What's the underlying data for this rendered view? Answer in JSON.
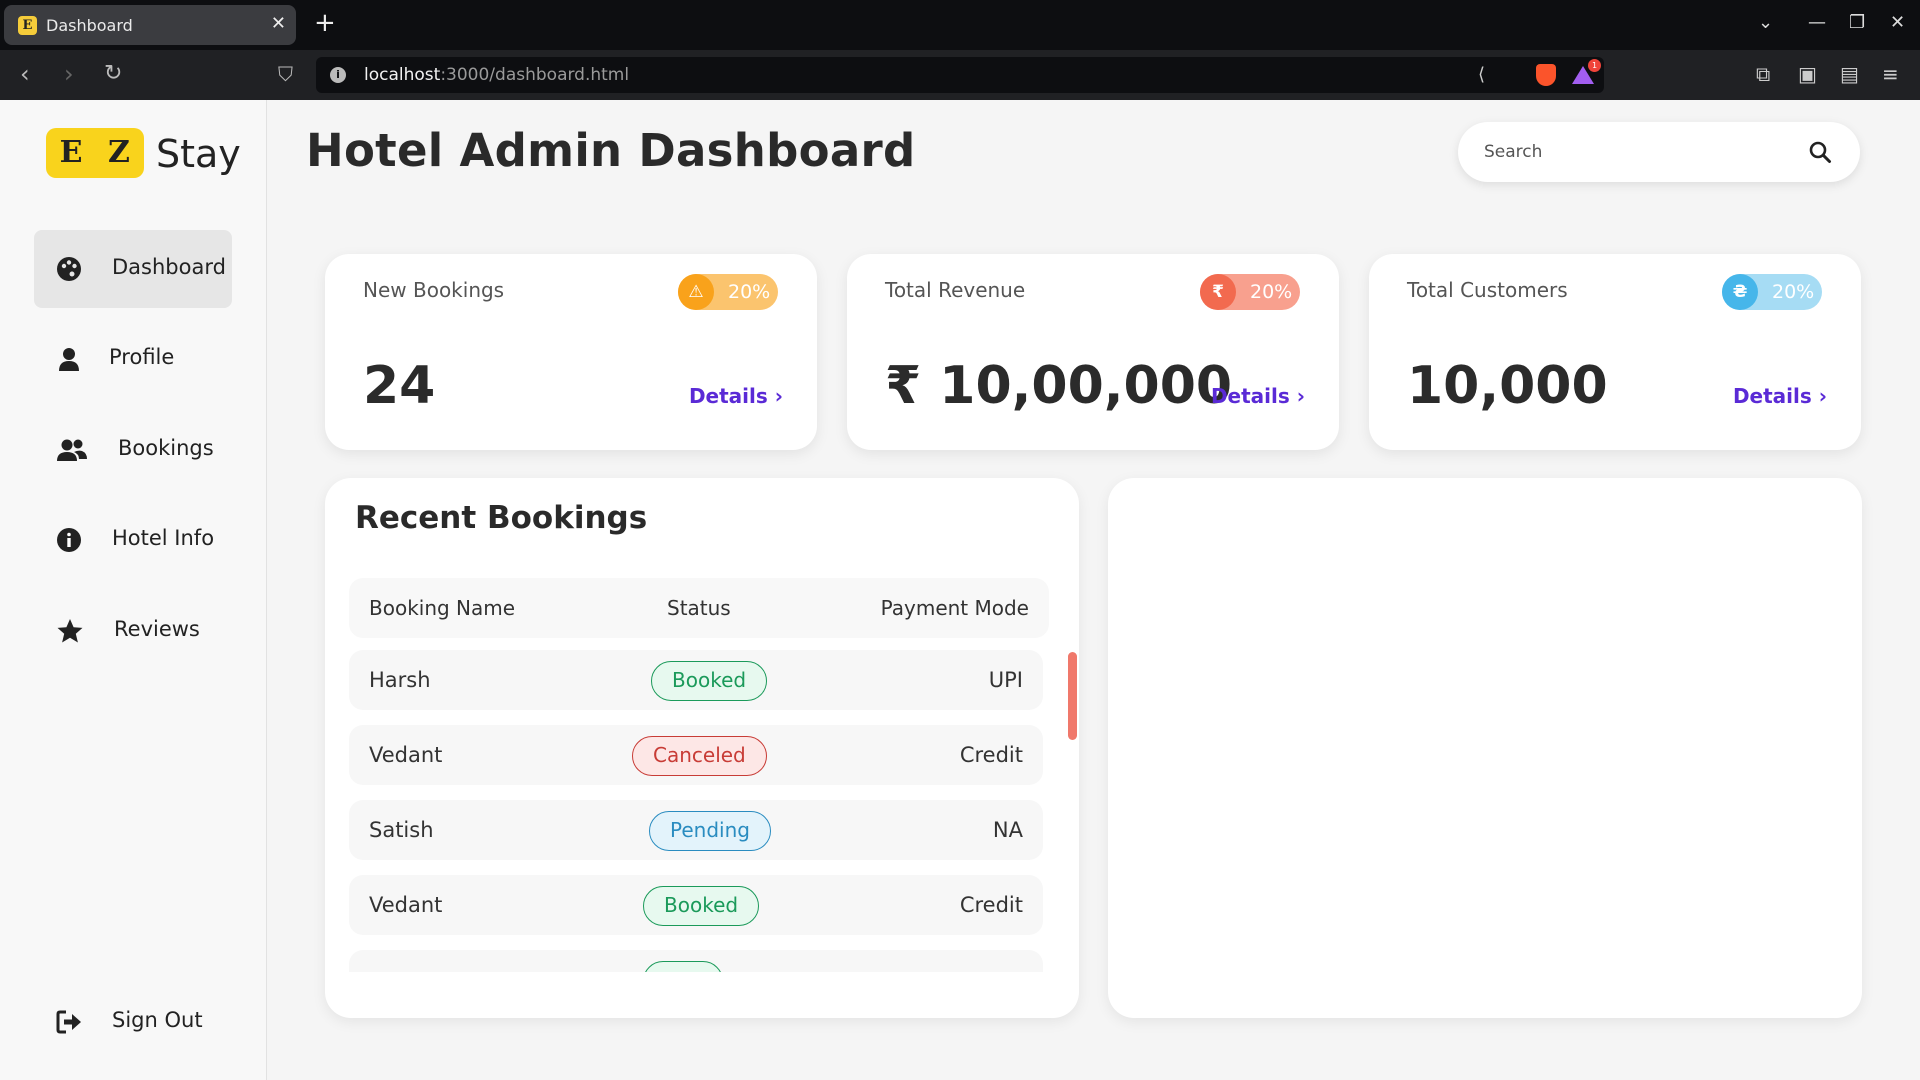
{
  "browser": {
    "tab_title": "Dashboard",
    "favicon_letter": "E",
    "url_host": "localhost",
    "url_path": ":3000/dashboard.html",
    "rewards_count": "1"
  },
  "logo": {
    "letter1": "E",
    "letter2": "Z",
    "word": "Stay"
  },
  "sidebar": {
    "items": [
      {
        "label": "Dashboard",
        "icon": "palette-icon",
        "active": true
      },
      {
        "label": "Profile",
        "icon": "user-icon",
        "active": false
      },
      {
        "label": "Bookings",
        "icon": "users-icon",
        "active": false
      },
      {
        "label": "Hotel Info",
        "icon": "info-icon",
        "active": false
      },
      {
        "label": "Reviews",
        "icon": "star-icon",
        "active": false
      }
    ],
    "signout": "Sign Out"
  },
  "header": {
    "title": "Hotel Admin Dashboard",
    "search_placeholder": "Search"
  },
  "stats": [
    {
      "title": "New Bookings",
      "badge": "20%",
      "value": "24",
      "details": "Details ›",
      "icon": "warning-icon",
      "icon_glyph": "⚠",
      "color": "#f9a21b",
      "light": "#fbc46e"
    },
    {
      "title": "Total Revenue",
      "badge": "20%",
      "value": "₹ 10,00,000",
      "details": "Details ›",
      "icon": "rupee-icon",
      "icon_glyph": "₹",
      "color": "#f26a4f",
      "light": "#f8a08e"
    },
    {
      "title": "Total Customers",
      "badge": "20%",
      "value": "10,000",
      "details": "Details ›",
      "icon": "hryvnia-icon",
      "icon_glyph": "₴",
      "color": "#46b6ea",
      "light": "#a6dcf4"
    }
  ],
  "recent": {
    "title": "Recent Bookings",
    "headers": [
      "Booking Name",
      "Status",
      "Payment Mode"
    ],
    "rows": [
      {
        "name": "Harsh",
        "status": "Booked",
        "payment": "UPI"
      },
      {
        "name": "Vedant",
        "status": "Canceled",
        "payment": "Credit"
      },
      {
        "name": "Satish",
        "status": "Pending",
        "payment": "NA"
      },
      {
        "name": "Vedant",
        "status": "Booked",
        "payment": "Credit"
      }
    ]
  },
  "colors": {
    "accent": "#5a2ad6",
    "logo_yellow": "#f9d31c"
  }
}
